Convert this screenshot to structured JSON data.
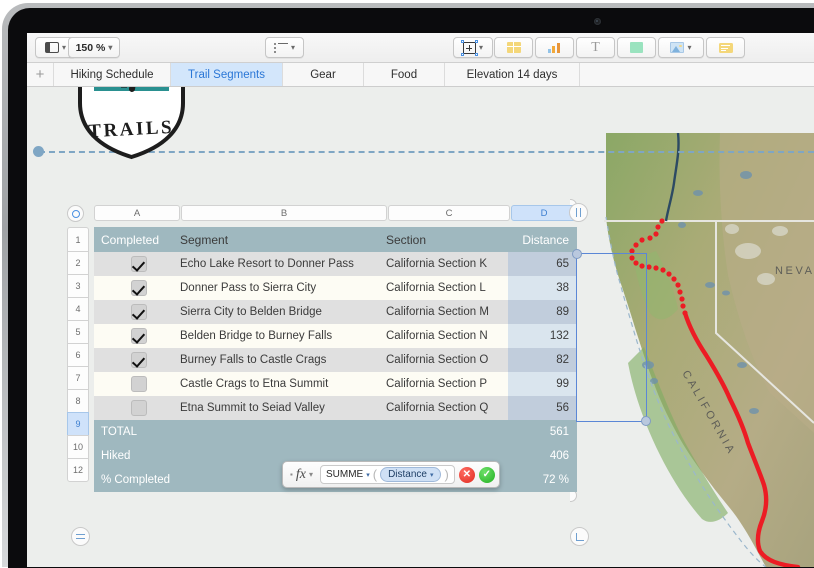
{
  "toolbar": {
    "view_label": "",
    "zoom_label": "150 %",
    "buttons": [
      {
        "name": "view-options",
        "icon": "sidebar-icon"
      },
      {
        "name": "zoom-level",
        "icon": "chevron-down-icon"
      },
      {
        "name": "list-format",
        "icon": "list-icon"
      },
      {
        "name": "insert-object",
        "icon": "add-object-icon"
      },
      {
        "name": "insert-table",
        "icon": "table-icon"
      },
      {
        "name": "insert-chart",
        "icon": "chart-icon"
      },
      {
        "name": "insert-text",
        "icon": "text-icon"
      },
      {
        "name": "insert-shape",
        "icon": "shape-icon"
      },
      {
        "name": "insert-media",
        "icon": "media-icon"
      },
      {
        "name": "insert-comment",
        "icon": "comment-icon"
      }
    ]
  },
  "tabs": {
    "add_label": "+",
    "items": [
      {
        "label": "Hiking Schedule",
        "active": false
      },
      {
        "label": "Trail Segments",
        "active": true
      },
      {
        "label": "Gear",
        "active": false
      },
      {
        "label": "Food",
        "active": false
      },
      {
        "label": "Elevation 14 days",
        "active": false
      }
    ]
  },
  "logo": {
    "text": "TRAILS",
    "badge_color": "#2a9090"
  },
  "sheet": {
    "columns": [
      "A",
      "B",
      "C",
      "D"
    ],
    "selected_column": "D",
    "row_numbers": [
      "1",
      "2",
      "3",
      "4",
      "5",
      "6",
      "7",
      "8",
      "9",
      "10",
      "12"
    ],
    "selected_row": "9",
    "headers": [
      "Completed",
      "Segment",
      "Section",
      "Distance"
    ],
    "rows": [
      {
        "completed": true,
        "segment": "Echo Lake Resort to Donner Pass",
        "section": "California Section K",
        "distance": "65"
      },
      {
        "completed": true,
        "segment": "Donner Pass to Sierra City",
        "section": "California Section L",
        "distance": "38"
      },
      {
        "completed": true,
        "segment": "Sierra City to Belden Bridge",
        "section": "California Section M",
        "distance": "89"
      },
      {
        "completed": true,
        "segment": "Belden Bridge to Burney Falls",
        "section": "California Section N",
        "distance": "132"
      },
      {
        "completed": true,
        "segment": "Burney Falls to Castle Crags",
        "section": "California Section O",
        "distance": "82"
      },
      {
        "completed": false,
        "segment": "Castle Crags to Etna Summit",
        "section": "California Section P",
        "distance": "99"
      },
      {
        "completed": false,
        "segment": "Etna Summit to Seiad Valley",
        "section": "California Section Q",
        "distance": "56"
      }
    ],
    "summary": [
      {
        "label": "TOTAL",
        "value": "561"
      },
      {
        "label": "Hiked",
        "value": "406"
      },
      {
        "label": "% Completed",
        "value": "72 %"
      }
    ]
  },
  "formula_editor": {
    "fx_label": "fx",
    "function_token": "SUMME",
    "argument_token": "Distance",
    "open_paren": "(",
    "close_paren": ")",
    "cancel_label": "✕",
    "accept_label": "✓"
  },
  "map": {
    "labels": [
      "NEVADA",
      "CALIFORNIA"
    ],
    "trail_color": "#ec1c24",
    "river_color": "#2c4a63"
  },
  "colors": {
    "accent": "#2b77d6",
    "table_header_bg": "#9fb8bf",
    "selection_border": "#5b87d6",
    "guide": "#7fa6c4"
  }
}
